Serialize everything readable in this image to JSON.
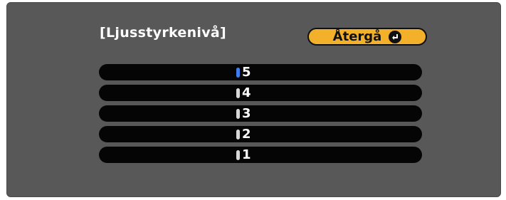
{
  "dialog": {
    "title": "[Ljusstyrkenivå]",
    "back_button": {
      "label": "Återgå",
      "icon": "enter-icon"
    }
  },
  "options": [
    {
      "label": "5",
      "selected": true
    },
    {
      "label": "4",
      "selected": false
    },
    {
      "label": "3",
      "selected": false
    },
    {
      "label": "2",
      "selected": false
    },
    {
      "label": "1",
      "selected": false
    }
  ],
  "colors": {
    "panel": "#585858",
    "button": "#f3b12b",
    "row": "#050505",
    "selected_marker": "#3f7df0"
  }
}
